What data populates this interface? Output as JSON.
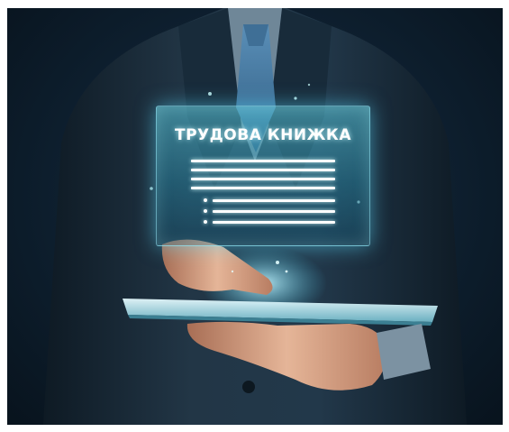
{
  "hologram": {
    "title": "ТРУДОВА КНИЖКА"
  },
  "colors": {
    "background": "#0b1a26",
    "suit": "#1a2a38",
    "shirt": "#6f8798",
    "tie": "#4a7ea8",
    "hologram_glow": "#5ad6ef",
    "skin": "#d9a88a",
    "tablet": "#bfe6ef"
  }
}
